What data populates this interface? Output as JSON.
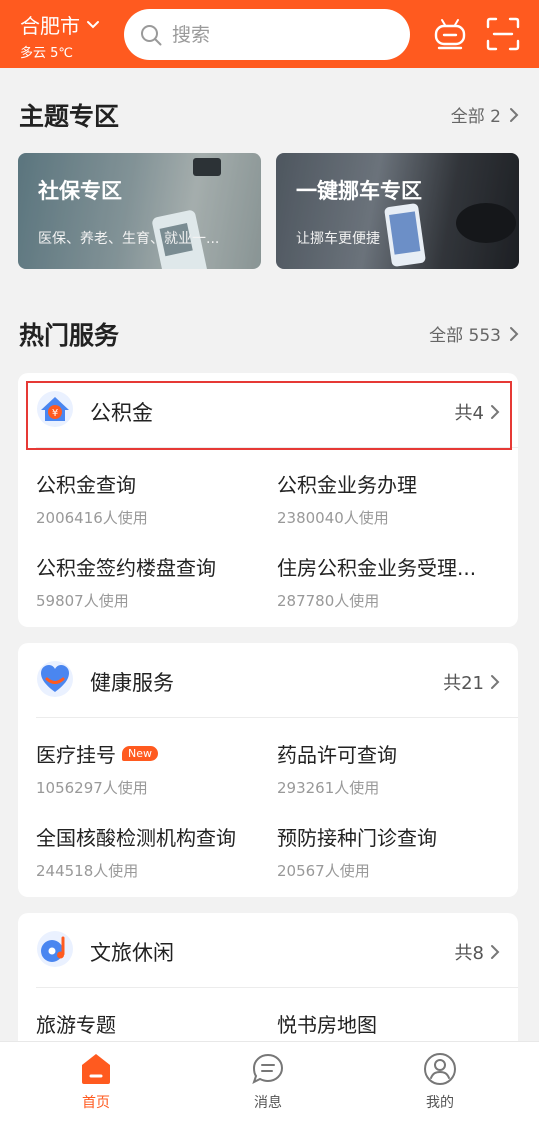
{
  "header": {
    "city": "合肥市",
    "weather": "多云 5℃",
    "search_placeholder": "搜索"
  },
  "themes": {
    "title": "主题专区",
    "more": "全部 2",
    "banners": [
      {
        "title": "社保专区",
        "subtitle": "医保、养老、生育、就业一..."
      },
      {
        "title": "一键挪车专区",
        "subtitle": "让挪车更便捷"
      }
    ]
  },
  "hot": {
    "title": "热门服务",
    "more": "全部 553"
  },
  "cards": [
    {
      "title": "公积金",
      "count": "共4",
      "items": [
        {
          "name": "公积金查询",
          "users": "2006416人使用"
        },
        {
          "name": "公积金业务办理",
          "users": "2380040人使用"
        },
        {
          "name": "公积金签约楼盘查询",
          "users": "59807人使用"
        },
        {
          "name": "住房公积金业务受理...",
          "users": "287780人使用"
        }
      ]
    },
    {
      "title": "健康服务",
      "count": "共21",
      "items": [
        {
          "name": "医疗挂号",
          "users": "1056297人使用",
          "badge": "New"
        },
        {
          "name": "药品许可查询",
          "users": "293261人使用"
        },
        {
          "name": "全国核酸检测机构查询",
          "users": "244518人使用"
        },
        {
          "name": "预防接种门诊查询",
          "users": "20567人使用"
        }
      ]
    },
    {
      "title": "文旅休闲",
      "count": "共8",
      "items": [
        {
          "name": "旅游专题",
          "users": ""
        },
        {
          "name": "悦书房地图",
          "users": ""
        }
      ]
    }
  ],
  "tabbar": {
    "items": [
      {
        "label": "首页",
        "icon": "home-icon"
      },
      {
        "label": "消息",
        "icon": "message-icon"
      },
      {
        "label": "我的",
        "icon": "profile-icon"
      }
    ],
    "active": 0
  },
  "colors": {
    "brand": "#ff5a1f",
    "highlight_box": "#e63935"
  }
}
